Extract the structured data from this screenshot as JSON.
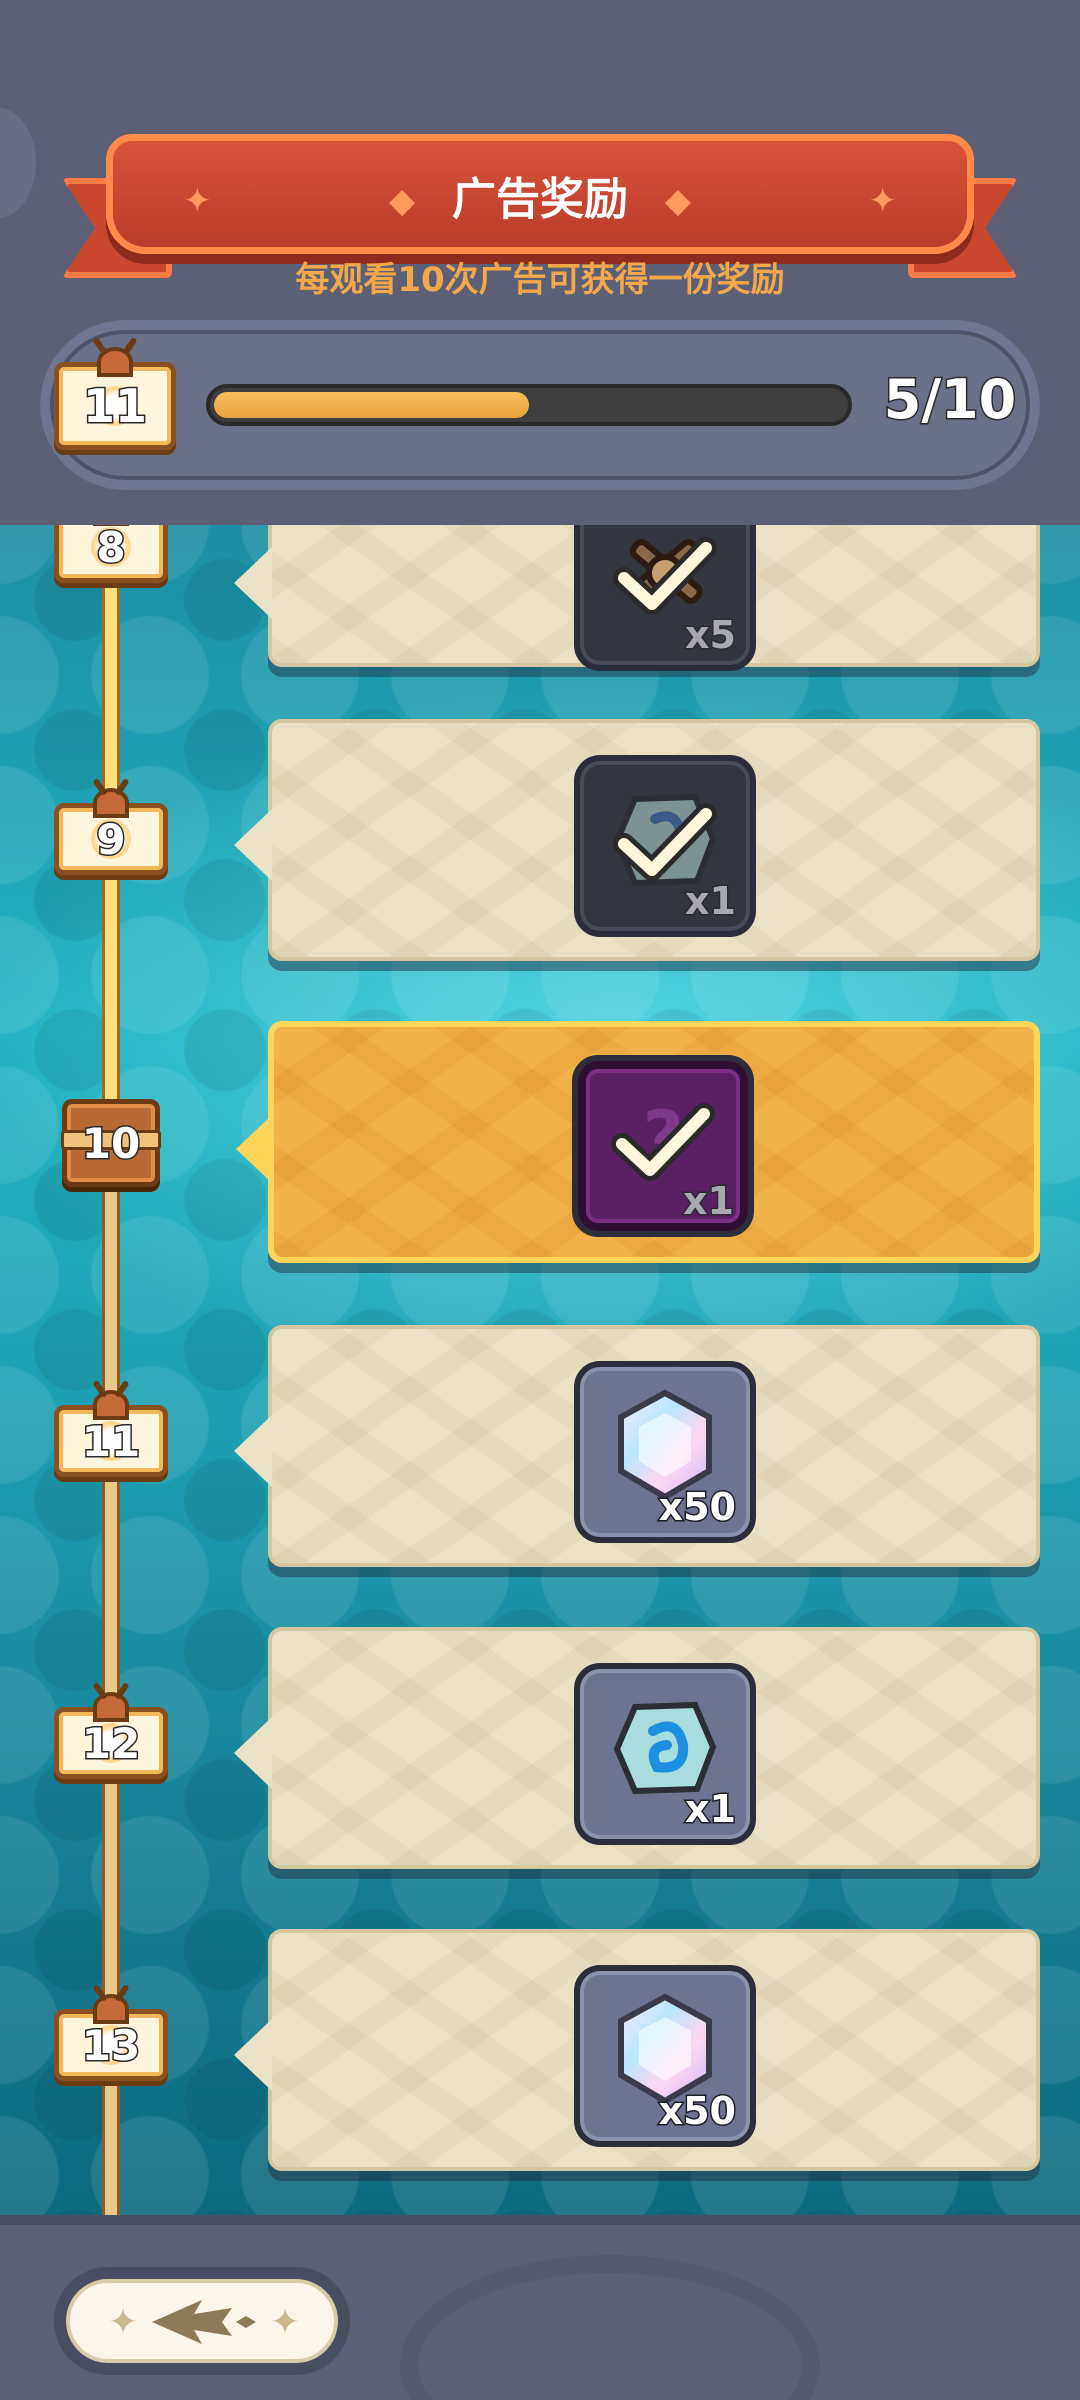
{
  "header": {
    "title": "广告奖励",
    "subtitle": "每观看10次广告可获得一份奖励",
    "current_level": "11",
    "progress_text": "5/10",
    "progress_fraction": 0.5
  },
  "rewards": [
    {
      "level": "8",
      "item": "crossed-weapons-token",
      "count": "x5",
      "claimed": true,
      "active": false,
      "node": "tv"
    },
    {
      "level": "9",
      "item": "dark-rune-stone",
      "count": "x1",
      "claimed": true,
      "active": false,
      "node": "tv"
    },
    {
      "level": "10",
      "item": "mystery-purple-card",
      "count": "x1",
      "claimed": true,
      "active": true,
      "node": "chest"
    },
    {
      "level": "11",
      "item": "rainbow-gem",
      "count": "x50",
      "claimed": false,
      "active": false,
      "node": "tv"
    },
    {
      "level": "12",
      "item": "blue-rune-stone",
      "count": "x1",
      "claimed": false,
      "active": false,
      "node": "tv"
    },
    {
      "level": "13",
      "item": "rainbow-gem",
      "count": "x50",
      "claimed": false,
      "active": false,
      "node": "tv"
    }
  ],
  "colors": {
    "banner": "#b93c2a",
    "subtitle": "#f5a84a",
    "progress_fill": "#e9a43e",
    "active_card": "#f2b24a",
    "card": "#ebe2c6"
  },
  "footer": {
    "back_button_icon": "back-arrow-icon"
  }
}
